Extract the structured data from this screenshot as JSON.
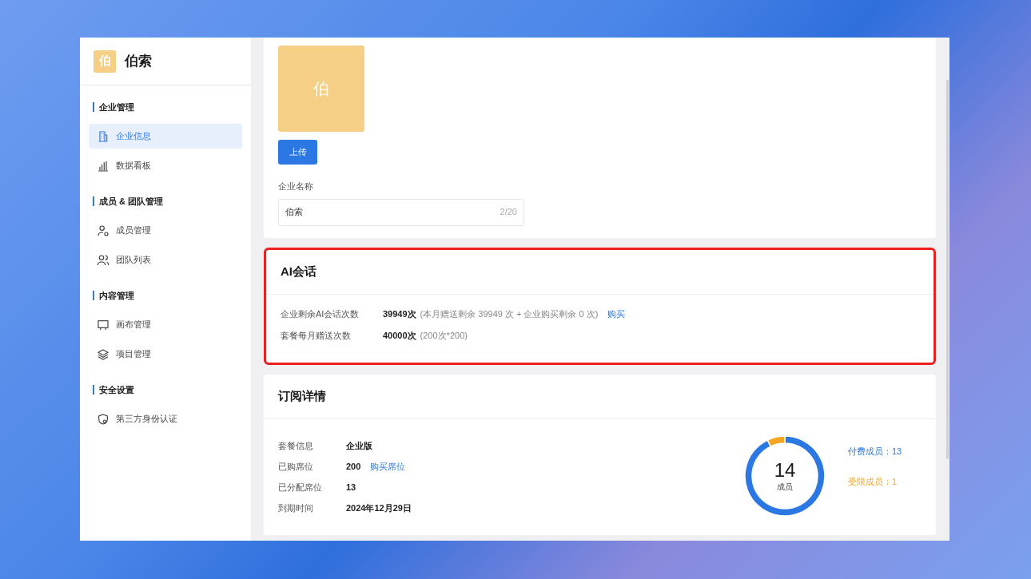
{
  "sidebar": {
    "logo": {
      "mark": "伯",
      "name": "伯索"
    },
    "groups": [
      {
        "title": "企业管理",
        "items": [
          {
            "label": "企业信息",
            "selected": true
          },
          {
            "label": "数据看板",
            "selected": false
          }
        ]
      },
      {
        "title": "成员 & 团队管理",
        "items": [
          {
            "label": "成员管理",
            "selected": false
          },
          {
            "label": "团队列表",
            "selected": false
          }
        ]
      },
      {
        "title": "内容管理",
        "items": [
          {
            "label": "画布管理",
            "selected": false
          },
          {
            "label": "项目管理",
            "selected": false
          }
        ]
      },
      {
        "title": "安全设置",
        "items": [
          {
            "label": "第三方身份认证",
            "selected": false
          }
        ]
      }
    ]
  },
  "profile": {
    "avatar": "伯",
    "upload_button": "上传",
    "name_field": {
      "label": "企业名称",
      "value": "伯索",
      "counter": "2/20"
    }
  },
  "ai_card": {
    "title": "AI会话",
    "highlighted": true,
    "rows": [
      {
        "label": "企业剩余AI会话次数",
        "value": "39949次",
        "detail": "(本月赠送剩余 39949 次 + 企业购买剩余 0 次)",
        "link": "购买"
      },
      {
        "label": "套餐每月赠送次数",
        "value": "40000次",
        "detail": "(200次*200)"
      }
    ]
  },
  "subscription": {
    "title": "订阅详情",
    "rows": [
      {
        "label": "套餐信息",
        "value": "企业版"
      },
      {
        "label": "已购席位",
        "value": "200",
        "link": "购买席位"
      },
      {
        "label": "已分配席位",
        "value": "13"
      },
      {
        "label": "到期时间",
        "value": "2024年12月29日"
      }
    ],
    "total": "14",
    "legend": [
      {
        "color": "#2b78e4"
      },
      {
        "color": "#f5a623"
      }
    ],
    "chart_data": {
      "type": "donut",
      "categories": [
        "付费成员：13",
        "受限成员：1"
      ],
      "series": [
        {
          "name": "成员",
          "values": [
            13,
            1
          ]
        }
      ]
    }
  }
}
